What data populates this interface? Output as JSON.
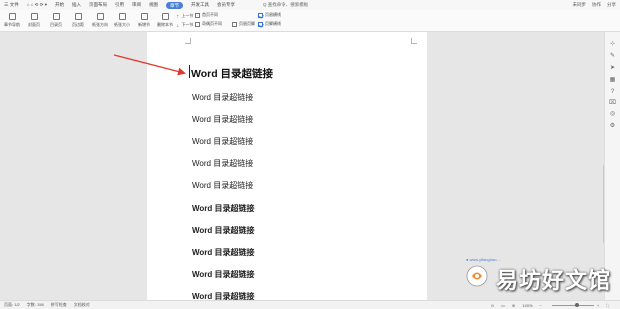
{
  "menubar": {
    "items": [
      "三 文件",
      "⌂ ⌂ ⟲ ⟳ ▾",
      "开始",
      "插入",
      "页面布局",
      "引用",
      "审阅",
      "视图",
      "章节",
      "开发工具",
      "会员专享"
    ],
    "active_index": 8,
    "search": "Q 查找命令、搜索模板",
    "right": [
      "未同步",
      "协作",
      "分享"
    ]
  },
  "ribbon": {
    "buttons": [
      "章节导航",
      "封面页",
      "目录页",
      "页边距",
      "纸张方向",
      "纸张大小",
      "新增节",
      "删除本节"
    ],
    "prev_label": "上一节",
    "next_label": "下一节",
    "options": [
      {
        "label": "首页不同",
        "checked": false
      },
      {
        "label": "奇偶页不同",
        "checked": false
      },
      {
        "label": "页眉页脚",
        "checked": false
      },
      {
        "label": "页眉横线",
        "checked": true
      },
      {
        "label": "页脚横线",
        "checked": true
      }
    ]
  },
  "document": {
    "heading": "Word 目录超链接",
    "entries": [
      {
        "text": "Word 目录超链接",
        "bold": false
      },
      {
        "text": "Word 目录超链接",
        "bold": false
      },
      {
        "text": "Word 目录超链接",
        "bold": false
      },
      {
        "text": "Word 目录超链接",
        "bold": false
      },
      {
        "text": "Word 目录超链接",
        "bold": false
      },
      {
        "text": "Word 目录超链接",
        "bold": true
      },
      {
        "text": "Word 目录超链接",
        "bold": true
      },
      {
        "text": "Word 目录超链接",
        "bold": true
      },
      {
        "text": "Word 目录超链接",
        "bold": true
      },
      {
        "text": "Word 目录超链接",
        "bold": true
      }
    ]
  },
  "statusbar": {
    "page": "页面: 1/2",
    "words": "字数: 156",
    "spellcheck": "拼写检查",
    "doc_check": "文档校对",
    "zoom": "120%",
    "zoom_level": 0.6
  },
  "watermark": {
    "text": "易坊好文馆",
    "mini": "● www.yifanghao..."
  },
  "colors": {
    "accent": "#4a7fd8",
    "arrow": "#e03a2f"
  }
}
